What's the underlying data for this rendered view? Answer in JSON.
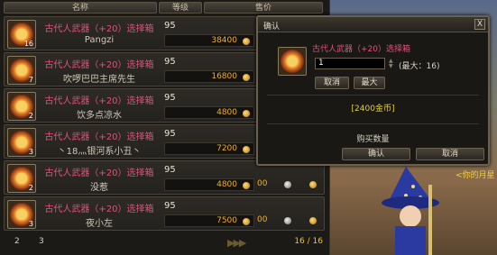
{
  "columns": {
    "name": "名称",
    "level": "等级",
    "price": "售价"
  },
  "items": [
    {
      "name": "古代人武器（+20）选择箱",
      "seller": "Pangzi",
      "level": "95",
      "price": "38400",
      "count": "16",
      "extra": ""
    },
    {
      "name": "古代人武器（+20）选择箱",
      "seller": "吹啰巴巴主席先生",
      "level": "95",
      "price": "16800",
      "count": "7",
      "extra": ""
    },
    {
      "name": "古代人武器（+20）选择箱",
      "seller": "饮多点凉水",
      "level": "95",
      "price": "4800",
      "count": "2",
      "extra": ""
    },
    {
      "name": "古代人武器（+20）选择箱",
      "seller": "丶18灬银河系小丑丶",
      "level": "95",
      "price": "7200",
      "count": "3",
      "extra": ""
    },
    {
      "name": "古代人武器（+20）选择箱",
      "seller": "没惹",
      "level": "95",
      "price": "4800",
      "count": "2",
      "extra": "00"
    },
    {
      "name": "古代人武器（+20）选择箱",
      "seller": "夜小左",
      "level": "95",
      "price": "7500",
      "count": "3",
      "extra": "00"
    }
  ],
  "pager": {
    "pages": [
      "2",
      "3"
    ],
    "count": "16 / 16"
  },
  "dialog": {
    "title": "确认",
    "close": "X",
    "item_name": "古代人武器（+20）选择箱",
    "qty_value": "1",
    "max_label": "(最大：16)",
    "cancel_small": "取消",
    "max_button": "最大",
    "total": "[2400金币]",
    "buy_qty_label": "购买数量",
    "confirm": "确认",
    "cancel": "取消"
  },
  "scene": {
    "text": "<你的月星"
  },
  "colors": {
    "item_name": "#e0507a",
    "gold": "#f0b020",
    "total": "#e0d040"
  }
}
